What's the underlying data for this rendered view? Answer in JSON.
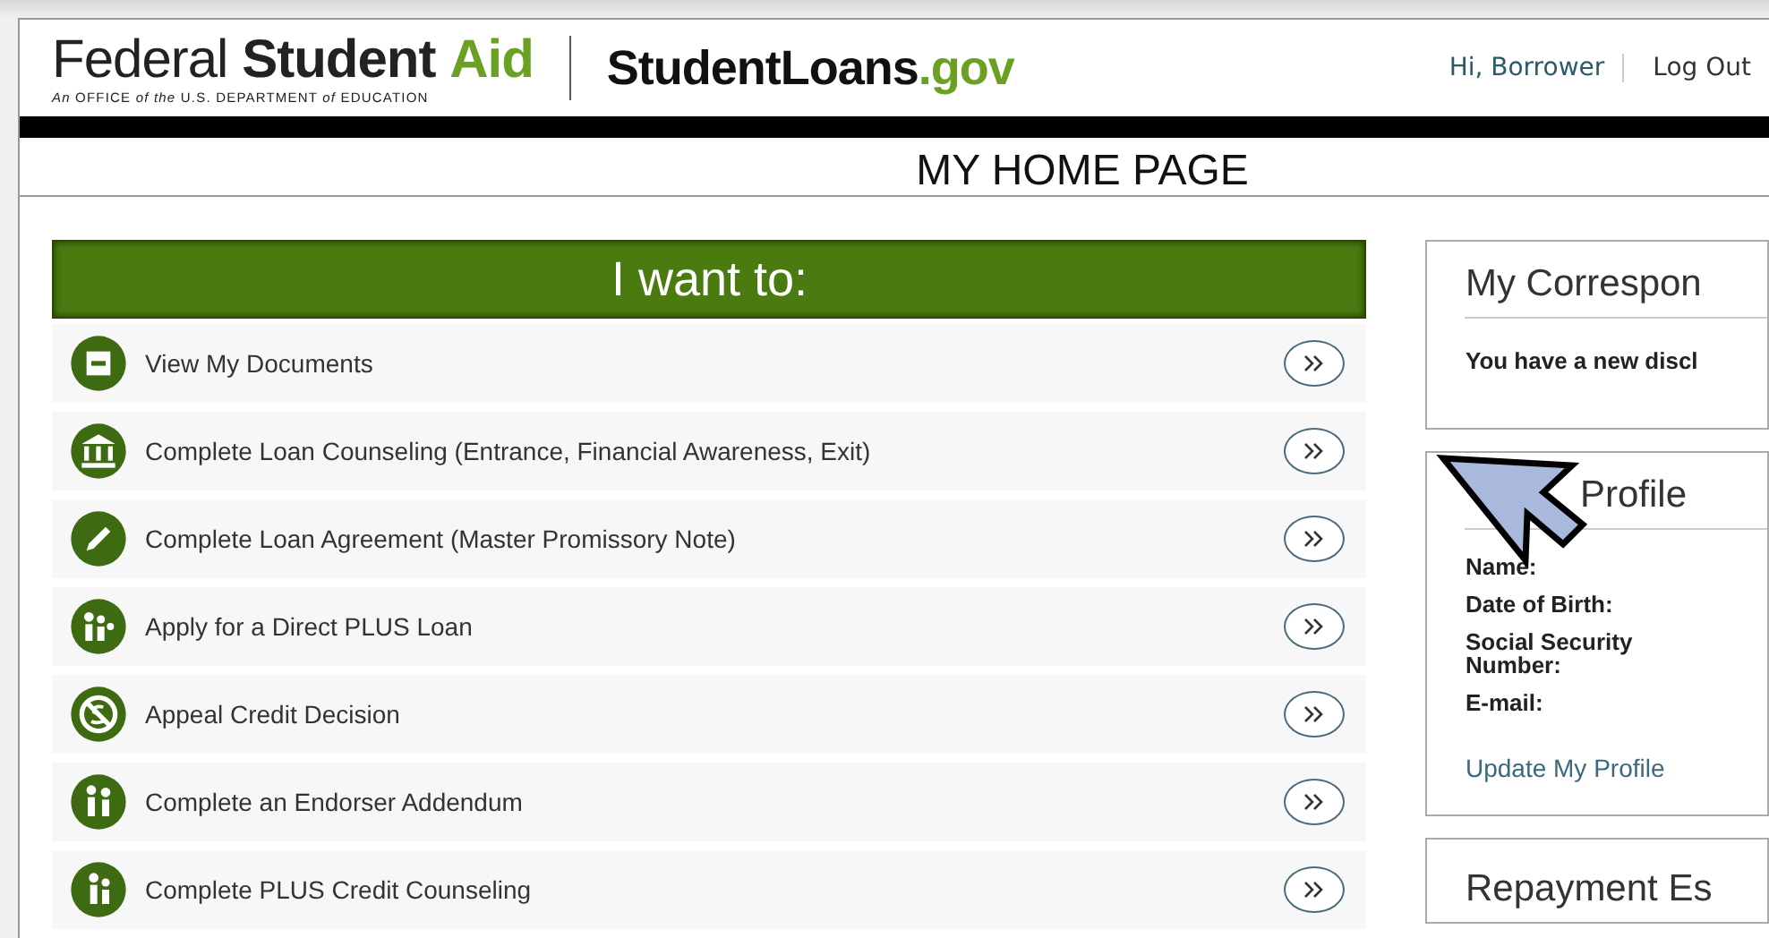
{
  "header": {
    "logo": "Federal **Student** *Aid*",
    "logo_subtitle": "*An* OFFICE *of the* U.S. DEPARTMENT *of* EDUCATION",
    "site": {
      "name": "StudentLoans",
      "domain": ".gov"
    },
    "greeting": "Hi, Borrower",
    "logout": "Log Out"
  },
  "page_title": "MY HOME PAGE",
  "actions": {
    "title": "I want to:",
    "items": [
      {
        "label": "View My Documents"
      },
      {
        "label": "Complete Loan Counseling (Entrance, Financial Awareness, Exit)"
      },
      {
        "label": "Complete Loan Agreement (Master Promissory Note)"
      },
      {
        "label": "Apply for a Direct PLUS Loan"
      },
      {
        "label": "Appeal Credit Decision"
      },
      {
        "label": "Complete an Endorser Addendum"
      },
      {
        "label": "Complete PLUS Credit Counseling"
      }
    ]
  },
  "correspondence": {
    "title": "My Correspon",
    "message": "You have a new discl"
  },
  "profile": {
    "title": "Profile",
    "fields": [
      "Name:",
      "Date of Birth:",
      "Social Security Number:",
      "E-mail:"
    ],
    "link": "Update My Profile"
  },
  "repayment": {
    "title": "Repayment Es"
  }
}
